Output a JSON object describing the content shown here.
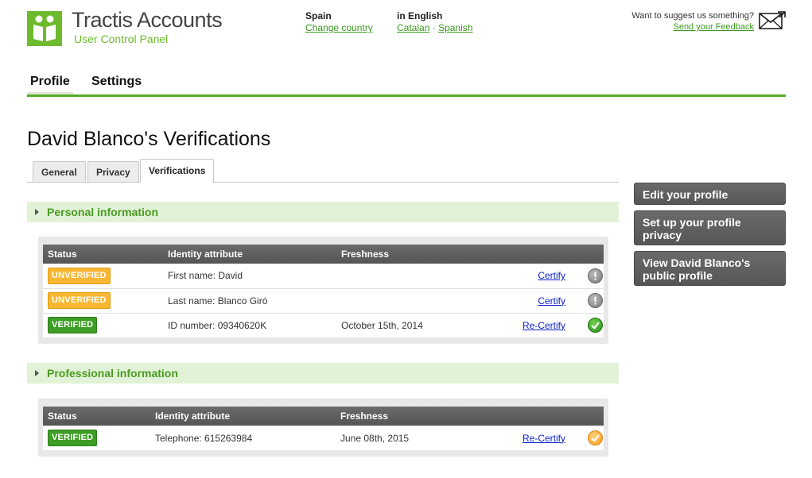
{
  "app": {
    "title": "Tractis Accounts",
    "subtitle": "User Control Panel"
  },
  "locale": {
    "country_label": "Spain",
    "change_country": "Change country",
    "language_label": "in English",
    "lang_catalan": "Catalan",
    "lang_sep": "·",
    "lang_spanish": "Spanish"
  },
  "feedback": {
    "prompt": "Want to suggest us something?",
    "link": "Send your Feedback"
  },
  "mainnav": [
    {
      "label": "Profile",
      "active": true
    },
    {
      "label": "Settings",
      "active": false
    }
  ],
  "page_title": "David Blanco's Verifications",
  "tabs": [
    {
      "label": "General"
    },
    {
      "label": "Privacy"
    },
    {
      "label": "Verifications"
    }
  ],
  "sections": [
    {
      "title": "Personal information",
      "columns": [
        "Status",
        "Identity attribute",
        "Freshness"
      ],
      "rows": [
        {
          "status": "UNVERIFIED",
          "attribute": "First name: David",
          "freshness": "",
          "action": "Certify",
          "icon": "exclamation-icon"
        },
        {
          "status": "UNVERIFIED",
          "attribute": "Last name: Blanco Giró",
          "freshness": "",
          "action": "Certify",
          "icon": "exclamation-icon"
        },
        {
          "status": "VERIFIED",
          "attribute": "ID number: 09340620K",
          "freshness": "October 15th, 2014",
          "action": "Re-Certify",
          "icon": "check-icon"
        }
      ]
    },
    {
      "title": "Professional information",
      "columns": [
        "Status",
        "Identity attribute",
        "Freshness"
      ],
      "rows": [
        {
          "status": "VERIFIED",
          "attribute": "Telephone: 615263984",
          "freshness": "June 08th, 2015",
          "action": "Re-Certify",
          "icon": "check-icon"
        }
      ]
    }
  ],
  "sidebar": {
    "edit_profile": "Edit your profile",
    "privacy": "Set up your profile privacy",
    "public_profile": "View David Blanco's public profile"
  },
  "colors": {
    "brand_green": "#5aab2b",
    "unverified": "#f7b733",
    "verified": "#3d9d24",
    "section_bg": "#e2f2d6"
  }
}
